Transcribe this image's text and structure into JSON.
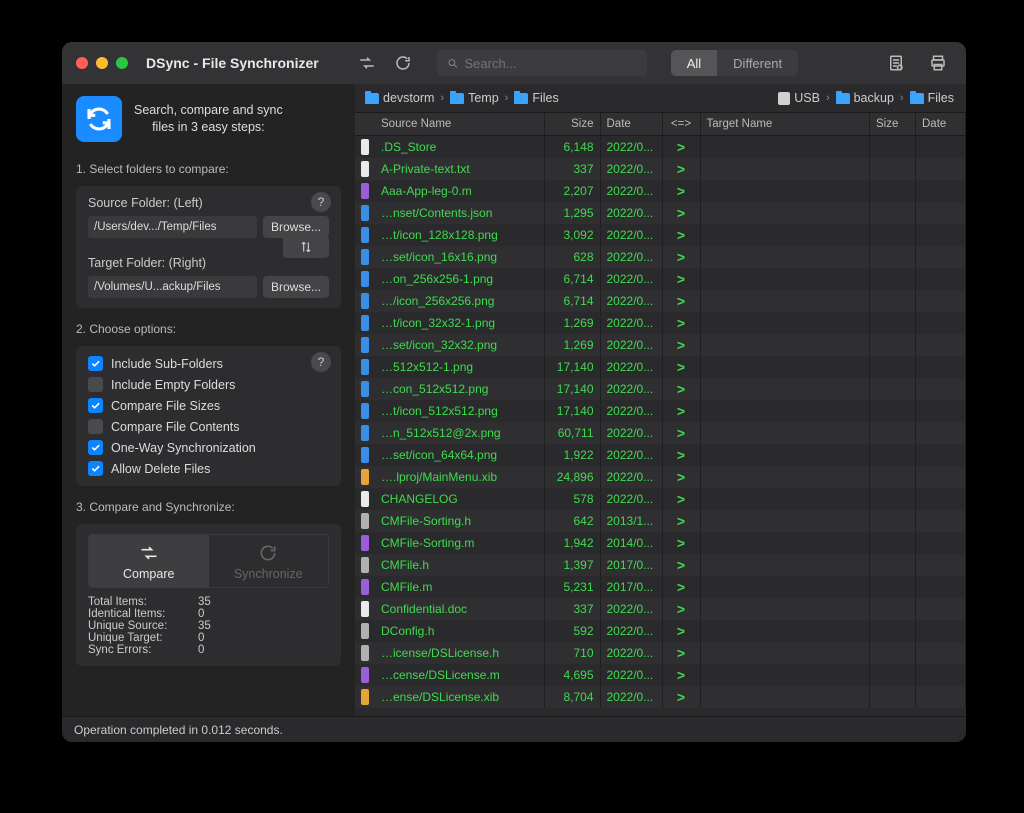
{
  "window": {
    "title": "DSync - File Synchronizer"
  },
  "toolbar": {
    "search_placeholder": "Search...",
    "filter_all": "All",
    "filter_different": "Different"
  },
  "intro": {
    "line1": "Search, compare and sync",
    "line2": "files in 3 easy steps:"
  },
  "steps": {
    "select": "1. Select folders to compare:",
    "options": "2. Choose options:",
    "compare": "3. Compare and Synchronize:"
  },
  "folders": {
    "source_label": "Source Folder: (Left)",
    "source_path": "/Users/dev.../Temp/Files",
    "target_label": "Target Folder: (Right)",
    "target_path": "/Volumes/U...ackup/Files",
    "browse": "Browse..."
  },
  "options": [
    {
      "label": "Include Sub-Folders",
      "checked": true
    },
    {
      "label": "Include Empty Folders",
      "checked": false
    },
    {
      "label": "Compare File Sizes",
      "checked": true
    },
    {
      "label": "Compare File Contents",
      "checked": false
    },
    {
      "label": "One-Way Synchronization",
      "checked": true
    },
    {
      "label": "Allow Delete Files",
      "checked": true
    }
  ],
  "actions": {
    "compare": "Compare",
    "synchronize": "Synchronize"
  },
  "stats": {
    "total_label": "Total Items:",
    "total": "35",
    "identical_label": "Identical Items:",
    "identical": "0",
    "unique_source_label": "Unique Source:",
    "unique_source": "35",
    "unique_target_label": "Unique Target:",
    "unique_target": "0",
    "errors_label": "Sync Errors:",
    "errors": "0"
  },
  "breadcrumbs": {
    "left": [
      "devstorm",
      "Temp",
      "Files"
    ],
    "right_disk": "USB",
    "right": [
      "backup",
      "Files"
    ]
  },
  "columns": {
    "source_name": "Source Name",
    "size": "Size",
    "date": "Date",
    "dir": "<=>",
    "target_name": "Target Name",
    "tsize": "Size",
    "tdate": "Date"
  },
  "rows": [
    {
      "icon": "white",
      "name": ".DS_Store",
      "size": "6,148",
      "date": "2022/0...",
      "dir": ">"
    },
    {
      "icon": "white",
      "name": "A-Private-text.txt",
      "size": "337",
      "date": "2022/0...",
      "dir": ">"
    },
    {
      "icon": "purple",
      "name": "Aaa-App-leg-0.m",
      "size": "2,207",
      "date": "2022/0...",
      "dir": ">"
    },
    {
      "icon": "blue",
      "name": "…nset/Contents.json",
      "size": "1,295",
      "date": "2022/0...",
      "dir": ">"
    },
    {
      "icon": "blue",
      "name": "…t/icon_128x128.png",
      "size": "3,092",
      "date": "2022/0...",
      "dir": ">"
    },
    {
      "icon": "blue",
      "name": "…set/icon_16x16.png",
      "size": "628",
      "date": "2022/0...",
      "dir": ">"
    },
    {
      "icon": "blue",
      "name": "…on_256x256-1.png",
      "size": "6,714",
      "date": "2022/0...",
      "dir": ">"
    },
    {
      "icon": "blue",
      "name": "…/icon_256x256.png",
      "size": "6,714",
      "date": "2022/0...",
      "dir": ">"
    },
    {
      "icon": "blue",
      "name": "…t/icon_32x32-1.png",
      "size": "1,269",
      "date": "2022/0...",
      "dir": ">"
    },
    {
      "icon": "blue",
      "name": "…set/icon_32x32.png",
      "size": "1,269",
      "date": "2022/0...",
      "dir": ">"
    },
    {
      "icon": "blue",
      "name": "…512x512-1.png",
      "size": "17,140",
      "date": "2022/0...",
      "dir": ">"
    },
    {
      "icon": "blue",
      "name": "…con_512x512.png",
      "size": "17,140",
      "date": "2022/0...",
      "dir": ">"
    },
    {
      "icon": "blue",
      "name": "…t/icon_512x512.png",
      "size": "17,140",
      "date": "2022/0...",
      "dir": ">"
    },
    {
      "icon": "blue",
      "name": "…n_512x512@2x.png",
      "size": "60,711",
      "date": "2022/0...",
      "dir": ">"
    },
    {
      "icon": "blue",
      "name": "…set/icon_64x64.png",
      "size": "1,922",
      "date": "2022/0...",
      "dir": ">"
    },
    {
      "icon": "orange",
      "name": "….lproj/MainMenu.xib",
      "size": "24,896",
      "date": "2022/0...",
      "dir": ">"
    },
    {
      "icon": "white",
      "name": "CHANGELOG",
      "size": "578",
      "date": "2022/0...",
      "dir": ">"
    },
    {
      "icon": "gray",
      "name": "CMFile-Sorting.h",
      "size": "642",
      "date": "2013/1...",
      "dir": ">"
    },
    {
      "icon": "purple",
      "name": "CMFile-Sorting.m",
      "size": "1,942",
      "date": "2014/0...",
      "dir": ">"
    },
    {
      "icon": "gray",
      "name": "CMFile.h",
      "size": "1,397",
      "date": "2017/0...",
      "dir": ">"
    },
    {
      "icon": "purple",
      "name": "CMFile.m",
      "size": "5,231",
      "date": "2017/0...",
      "dir": ">"
    },
    {
      "icon": "white",
      "name": "Confidential.doc",
      "size": "337",
      "date": "2022/0...",
      "dir": ">"
    },
    {
      "icon": "gray",
      "name": "DConfig.h",
      "size": "592",
      "date": "2022/0...",
      "dir": ">"
    },
    {
      "icon": "gray",
      "name": "…icense/DSLicense.h",
      "size": "710",
      "date": "2022/0...",
      "dir": ">"
    },
    {
      "icon": "purple",
      "name": "…cense/DSLicense.m",
      "size": "4,695",
      "date": "2022/0...",
      "dir": ">"
    },
    {
      "icon": "orange",
      "name": "…ense/DSLicense.xib",
      "size": "8,704",
      "date": "2022/0...",
      "dir": ">"
    }
  ],
  "statusbar": "Operation completed in 0.012 seconds."
}
